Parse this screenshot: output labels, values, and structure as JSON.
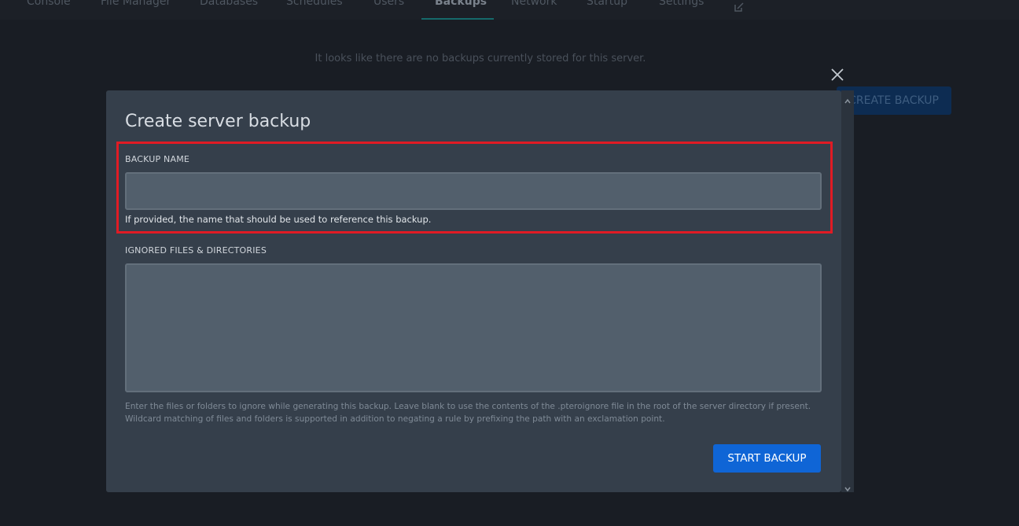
{
  "nav": {
    "items": [
      {
        "label": "Console"
      },
      {
        "label": "File Manager"
      },
      {
        "label": "Databases"
      },
      {
        "label": "Schedules"
      },
      {
        "label": "Users"
      },
      {
        "label": "Backups"
      },
      {
        "label": "Network"
      },
      {
        "label": "Startup"
      },
      {
        "label": "Settings"
      }
    ],
    "active": "Backups"
  },
  "backups": {
    "empty_message": "It looks like there are no backups currently stored for this server.",
    "create_button_label": "CREATE BACKUP"
  },
  "modal": {
    "title": "Create server backup",
    "backup_name": {
      "label": "BACKUP NAME",
      "value": "",
      "helper": "If provided, the name that should be used to reference this backup."
    },
    "ignored": {
      "label": "IGNORED FILES & DIRECTORIES",
      "value": "",
      "helper": "Enter the files or folders to ignore while generating this backup. Leave blank to use the contents of the .pteroignore file in the root of the server directory if present. Wildcard matching of files and folders is supported in addition to negating a rule by prefixing the path with an exclamation point."
    },
    "submit_label": "START BACKUP"
  },
  "colors": {
    "accent": "#0f65d6",
    "highlight": "#e01b24",
    "nav_active_underline": "#166a6b"
  }
}
